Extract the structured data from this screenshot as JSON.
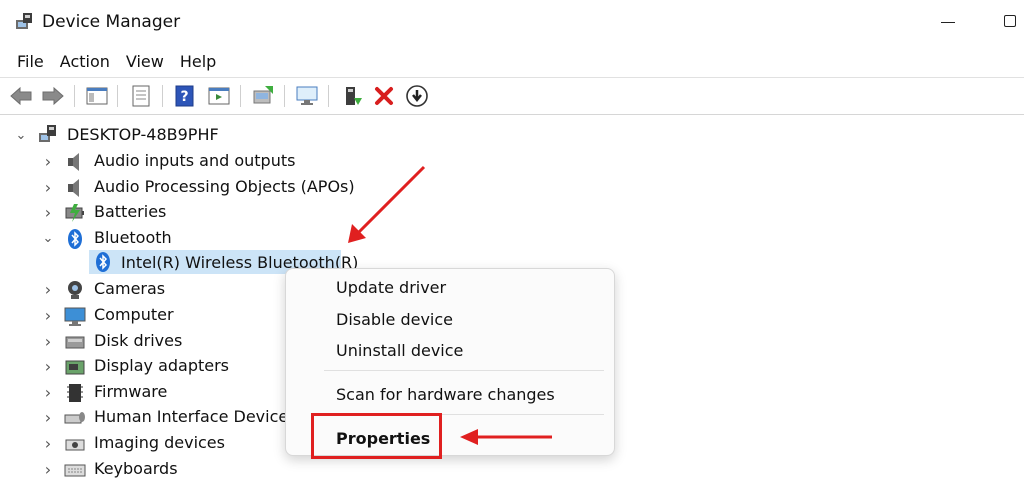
{
  "window": {
    "title": "Device Manager"
  },
  "menu": [
    "File",
    "Action",
    "View",
    "Help"
  ],
  "toolbar": {
    "buttons": [
      "back-icon",
      "forward-icon",
      "show-hide-tree-icon",
      "properties-icon",
      "help-icon",
      "action-pane-icon",
      "update-driver-icon",
      "scan-hardware-icon",
      "enable-device-icon",
      "uninstall-icon",
      "download-icon"
    ]
  },
  "tree": {
    "root": "DESKTOP-48B9PHF",
    "categories": [
      {
        "label": "Audio inputs and outputs",
        "icon": "speaker-icon"
      },
      {
        "label": "Audio Processing Objects (APOs)",
        "icon": "speaker-icon"
      },
      {
        "label": "Batteries",
        "icon": "battery-icon"
      },
      {
        "label": "Bluetooth",
        "icon": "bluetooth-icon",
        "expanded": true
      },
      {
        "label": "Cameras",
        "icon": "camera-icon"
      },
      {
        "label": "Computer",
        "icon": "computer-icon"
      },
      {
        "label": "Disk drives",
        "icon": "disk-icon"
      },
      {
        "label": "Display adapters",
        "icon": "display-adapter-icon"
      },
      {
        "label": "Firmware",
        "icon": "firmware-icon"
      },
      {
        "label": "Human Interface Devices",
        "icon": "hid-icon"
      },
      {
        "label": "Imaging devices",
        "icon": "imaging-icon"
      },
      {
        "label": "Keyboards",
        "icon": "keyboard-icon"
      }
    ],
    "bluetooth_child": "Intel(R) Wireless Bluetooth(R)"
  },
  "context_menu": {
    "items": [
      "Update driver",
      "Disable device",
      "Uninstall device",
      "Scan for hardware changes",
      "Properties"
    ]
  },
  "colors": {
    "selection": "#cce4f7",
    "annotation": "#e02020"
  }
}
